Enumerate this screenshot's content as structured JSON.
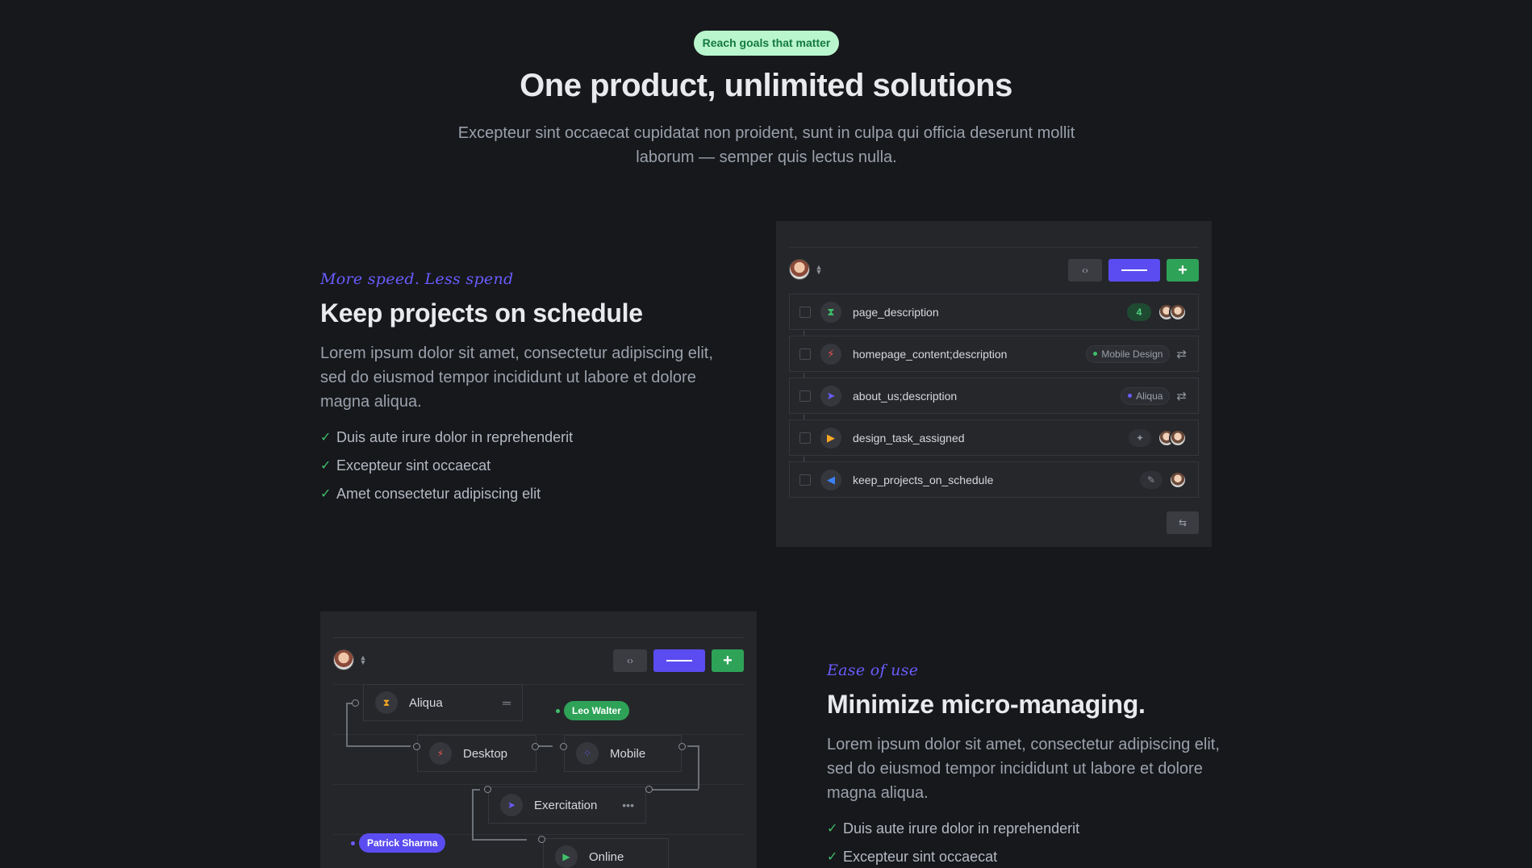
{
  "hero": {
    "badge": "Reach goals that matter",
    "title": "One product, unlimited solutions",
    "subtitle": "Excepteur sint occaecat cupidatat non proident, sunt in culpa qui officia deserunt mollit laborum — semper quis lectus nulla."
  },
  "section1": {
    "eyebrow": "More speed. Less spend",
    "title": "Keep projects on schedule",
    "body": "Lorem ipsum dolor sit amet, consectetur adipiscing elit, sed do eiusmod tempor incididunt ut labore et dolore magna aliqua.",
    "checks": [
      "Duis aute irure dolor in reprehenderit",
      "Excepteur sint occaecat",
      "Amet consectetur adipiscing elit"
    ]
  },
  "section2": {
    "eyebrow": "Ease of use",
    "title": "Minimize micro-managing.",
    "body": "Lorem ipsum dolor sit amet, consectetur adipiscing elit, sed do eiusmod tempor incididunt ut labore et dolore magna aliqua.",
    "checks": [
      "Duis aute irure dolor in reprehenderit",
      "Excepteur sint occaecat"
    ]
  },
  "tasks": {
    "toolbar": {
      "code_icon": "‹›",
      "add_icon": "+"
    },
    "rows": [
      {
        "name": "page_description",
        "icon": "hourglass-icon",
        "icon_glyph": "⧗",
        "icon_color": "#3fbf6a",
        "count": "4"
      },
      {
        "name": "homepage_content;description",
        "icon": "bolt-icon",
        "icon_glyph": "⚡",
        "icon_color": "#f05252",
        "tag": "Mobile Design",
        "tag_color": "#3fbf6a"
      },
      {
        "name": "about_us;description",
        "icon": "send-icon",
        "icon_glyph": "➤",
        "icon_color": "#6a5cff",
        "tag": "Aliqua",
        "tag_color": "#6a5cff"
      },
      {
        "name": "design_task_assigned",
        "icon": "play-icon",
        "icon_glyph": "▶",
        "icon_color": "#f5a623"
      },
      {
        "name": "keep_projects_on_schedule",
        "icon": "megaphone-icon",
        "icon_glyph": "◀",
        "icon_color": "#3b82f6"
      }
    ],
    "shuffle_glyph": "⇄",
    "sparkle_glyph": "✦",
    "feather_glyph": "✎",
    "settings_glyph": "⇆"
  },
  "flow": {
    "toolbar": {
      "code_icon": "‹›",
      "add_icon": "+"
    },
    "nodes": {
      "aliqua": {
        "label": "Aliqua",
        "glyph": "⧗",
        "color": "#f5a623",
        "extra": "═"
      },
      "desktop": {
        "label": "Desktop",
        "glyph": "⚡",
        "color": "#f05252"
      },
      "mobile": {
        "label": "Mobile",
        "glyph": "⁘",
        "color": "#6a5cff"
      },
      "exercitation": {
        "label": "Exercitation",
        "glyph": "➤",
        "color": "#6a5cff",
        "extra": "•••"
      },
      "online": {
        "label": "Online",
        "glyph": "▶",
        "color": "#3fbf6a"
      }
    },
    "people": [
      {
        "name": "Leo Walter",
        "color": "#2ea257",
        "dot": "#3fbf6a"
      },
      {
        "name": "Patrick Sharma",
        "color": "#5a4cf0",
        "dot": "#6a5cff"
      }
    ]
  }
}
